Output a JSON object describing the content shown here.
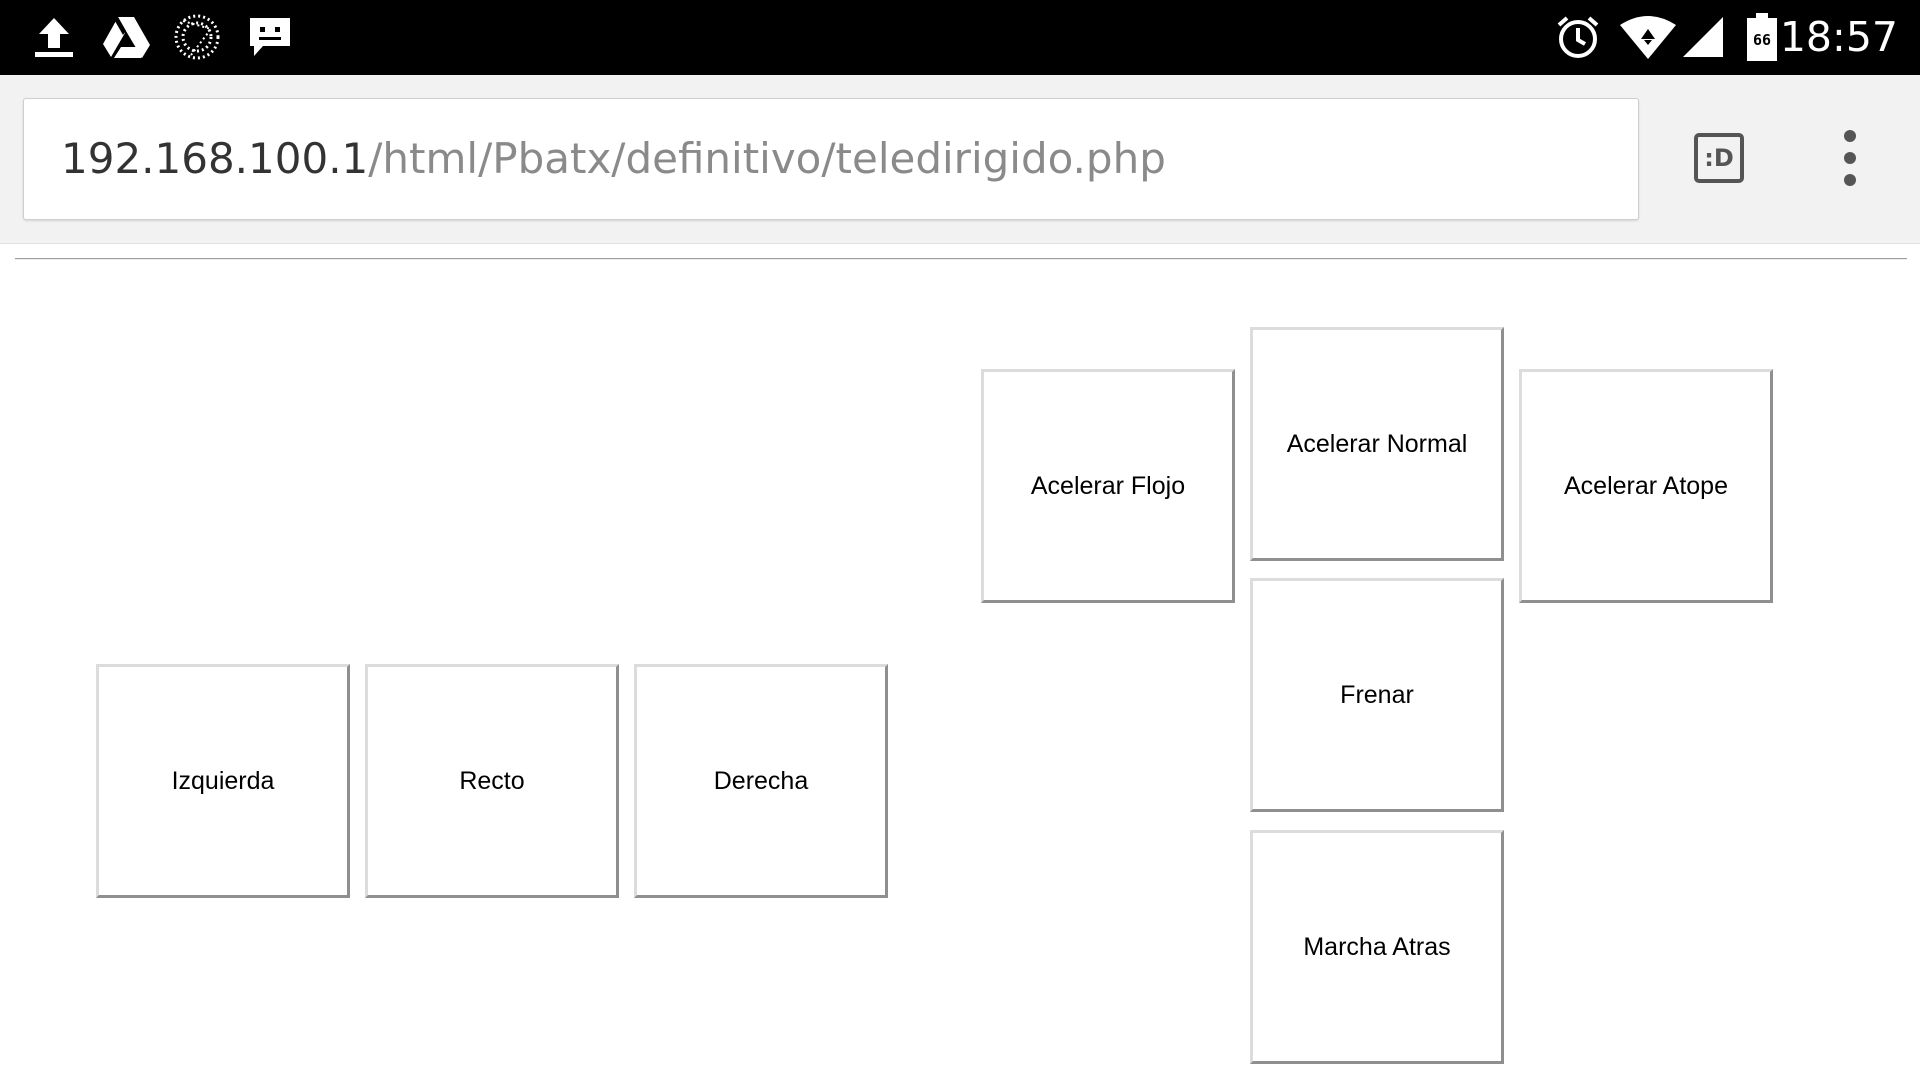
{
  "status_bar": {
    "time": "18:57",
    "battery_level": "66",
    "icons": [
      "upload-icon",
      "drive-icon",
      "dotted-circle-icon",
      "message-icon",
      "alarm-icon",
      "wifi-icon",
      "signal-icon",
      "battery-icon"
    ]
  },
  "browser": {
    "url_host": "192.168.100.1",
    "url_path": "/html/Pbatx/definitivo/teledirigido.php",
    "tab_switcher_label": ":D"
  },
  "controls": {
    "izquierda": "Izquierda",
    "recto": "Recto",
    "derecha": "Derecha",
    "acelerar_flojo": "Acelerar Flojo",
    "acelerar_normal": "Acelerar Normal",
    "acelerar_atope": "Acelerar Atope",
    "frenar": "Frenar",
    "marcha_atras": "Marcha Atras"
  }
}
